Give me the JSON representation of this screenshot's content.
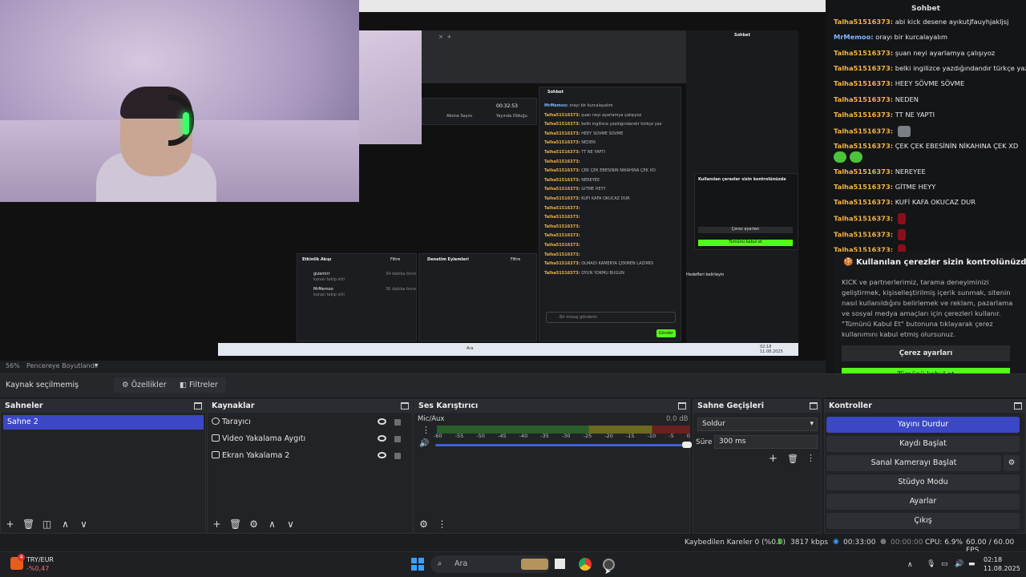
{
  "preview": {
    "inner_chat_title": "Sohbet",
    "inner_chat_title2": "Sohbet",
    "inner_stat_time": "00:32:53",
    "inner_stat_sub_label": "Abone Sayısı",
    "inner_stat_uptime_label": "Yayında Olduğu Süre",
    "inner_events_title": "Etkinlik Akışı",
    "inner_events_filter": "Filtre",
    "inner_mod_title": "Denetim Eylemleri",
    "inner_mod_filter": "Filtre",
    "inner_event1_name": "gizemirr",
    "inner_event1_desc": "kanalı takip etti",
    "inner_event1_time": "34 dakika önce",
    "inner_event2_name": "MrMemoo",
    "inner_event2_desc": "kanalı takip etti",
    "inner_event2_time": "36 dakika önce",
    "inner_send_placeholder": "Bir mesaj gönderin",
    "inner_send_button": "Gönder",
    "inner_cookie_title": "Kullanılan çerezler sizin kontrolünüzde",
    "inner_cookie_btn1": "Çerez ayarları",
    "inner_cookie_btn2": "Tümünü kabul et",
    "inner_goals": "Hedefleri belirleyin",
    "inner_search": "Ara",
    "inner_time": "02:18",
    "inner_date": "11.08.2025",
    "inner_chat_lines": [
      {
        "name": "MrMemoo:",
        "text": "orayı bir kurcalayalım",
        "blue": true
      },
      {
        "name": "Talha51516373:",
        "text": "şuan neyi ayarlamya çalışıyoz"
      },
      {
        "name": "Talha51516373:",
        "text": "belki ingilizce yazdığındandır türkçe yaz"
      },
      {
        "name": "Talha51516373:",
        "text": "HEEY SÖVME SÖVME"
      },
      {
        "name": "Talha51516373:",
        "text": "NEDEN"
      },
      {
        "name": "Talha51516373:",
        "text": "TT NE YAPTI"
      },
      {
        "name": "Talha51516373:",
        "text": ""
      },
      {
        "name": "Talha51516373:",
        "text": "ÇEK ÇEK EBESİNİN NİKAHINA ÇEK XD"
      },
      {
        "name": "Talha51516373:",
        "text": "NEREYEE"
      },
      {
        "name": "Talha51516373:",
        "text": "GİTME HEYY"
      },
      {
        "name": "Talha51516373:",
        "text": "KUFİ KAFA OKUCAZ DUR"
      },
      {
        "name": "Talha51516373:",
        "text": ""
      },
      {
        "name": "Talha51516373:",
        "text": ""
      },
      {
        "name": "Talha51516373:",
        "text": ""
      },
      {
        "name": "Talha51516373:",
        "text": ""
      },
      {
        "name": "Talha51516373:",
        "text": ""
      },
      {
        "name": "Talha51516373:",
        "text": ""
      },
      {
        "name": "Talha51516373:",
        "text": "OLMADI KAMERYA ÇEKMEN LAZIMDI"
      },
      {
        "name": "Talha51516373:",
        "text": "OYUN YOKMU BUGÜN"
      }
    ]
  },
  "chat": {
    "title": "Sohbet",
    "lines": [
      {
        "name": "Talha51516373:",
        "text": "abi kick desene ayıkutjfauyhjakljsj",
        "emote": ""
      },
      {
        "name": "MrMemoo:",
        "text": "orayı bir kurcalayalım",
        "blue": true,
        "emote": ""
      },
      {
        "name": "Talha51516373:",
        "text": "şuan neyi ayarlamya çalışıyoz",
        "emote": ""
      },
      {
        "name": "Talha51516373:",
        "text": "belki ingilizce yazdığındandır türkçe yaz",
        "emote": ""
      },
      {
        "name": "Talha51516373:",
        "text": "HEEY SÖVME SÖVME",
        "emote": ""
      },
      {
        "name": "Talha51516373:",
        "text": "NEDEN",
        "emote": ""
      },
      {
        "name": "Talha51516373:",
        "text": "TT NE YAPTI",
        "emote": ""
      },
      {
        "name": "Talha51516373:",
        "text": "",
        "emote": "grey"
      },
      {
        "name": "Talha51516373:",
        "text": "ÇEK ÇEK EBESİNİN NİKAHINA ÇEK XD",
        "emote": ""
      },
      {
        "name": "Talha51516373:",
        "text": "NEREYEE",
        "emote": ""
      },
      {
        "name": "Talha51516373:",
        "text": "GİTME HEYY",
        "emote": ""
      },
      {
        "name": "Talha51516373:",
        "text": "KUFİ KAFA OKUCAZ DUR",
        "emote": ""
      },
      {
        "name": "Talha51516373:",
        "text": "",
        "emote": "red"
      },
      {
        "name": "Talha51516373:",
        "text": "",
        "emote": "red"
      },
      {
        "name": "Talha51516373:",
        "text": "",
        "emote": "red"
      }
    ],
    "cookie_title": "Kullanılan çerezler sizin kontrolünüzde",
    "cookie_body": "KICK ve partnerlerimiz, tarama deneyiminizi geliştirmek, kişiselleştirilmiş içerik sunmak, sitenin nasıl kullanıldığını belirlemek ve reklam, pazarlama ve sosyal medya amaçları için çerezleri kullanır. \"Tümünü Kabul Et\" butonuna tıklayarak çerez kullanımını kabul etmiş olursunuz.",
    "cookie_settings": "Çerez ayarları",
    "cookie_accept": "Tümünü kabul et"
  },
  "zoom": {
    "value": "56%",
    "mode": "Pencereye Boyutlandır"
  },
  "source_toolbar": {
    "no_source": "Kaynak seçilmemiş",
    "properties": "Özellikler",
    "filters": "Filtreler"
  },
  "scenes": {
    "title": "Sahneler",
    "items": [
      "Sahne 2"
    ]
  },
  "sources": {
    "title": "Kaynaklar",
    "items": [
      "Tarayıcı",
      "Video Yakalama Aygıtı",
      "Ekran Yakalama 2"
    ]
  },
  "mixer": {
    "title": "Ses Karıştırıcı",
    "channel": "Mic/Aux",
    "level": "0.0 dB",
    "ticks": [
      "-60",
      "-55",
      "-50",
      "-45",
      "-40",
      "-35",
      "-30",
      "-25",
      "-20",
      "-15",
      "-10",
      "-5",
      "0"
    ]
  },
  "transitions": {
    "title": "Sahne Geçişleri",
    "selected": "Soldur",
    "duration_label": "Süre",
    "duration": "300 ms"
  },
  "controls": {
    "title": "Kontroller",
    "buttons": [
      "Yayını Durdur",
      "Kaydı Başlat",
      "Sanal Kamerayı Başlat",
      "Stüdyo Modu",
      "Ayarlar",
      "Çıkış"
    ]
  },
  "status": {
    "dropped": "Kaybedilen Kareler 0 (%0.0)",
    "bitrate": "3817 kbps",
    "stream_time": "00:33:00",
    "rec_time": "00:00:00",
    "cpu": "CPU: 6.9%",
    "fps": "60.00 / 60.00 FPS"
  },
  "taskbar": {
    "ticker_name": "TRY/EUR",
    "ticker_change": "-%0,47",
    "ticker_badge": "4",
    "search": "Ara",
    "time": "02:18",
    "date": "11.08.2025"
  },
  "colors": {
    "kick_green": "#53fc18",
    "obs_blue": "#3b47c4",
    "chat_name": "#f2b442"
  }
}
